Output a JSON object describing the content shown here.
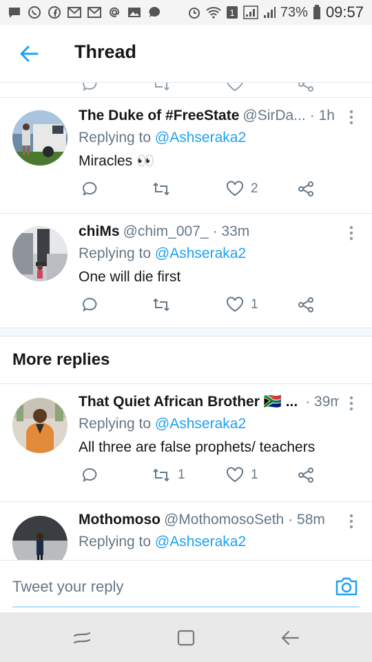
{
  "status_bar": {
    "battery": "73%",
    "time": "09:57",
    "sim_badge": "1",
    "colors": {
      "background": "#f4f4f4",
      "icon": "#555555"
    }
  },
  "header": {
    "title": "Thread",
    "back_icon": "arrow-left-icon"
  },
  "colors": {
    "accent": "#1da1f2",
    "text_primary": "#14171a",
    "text_secondary": "#657786",
    "divider": "#e1e8ed"
  },
  "tweets": [
    {
      "name": "The Duke of #FreeState",
      "handle": "@SirDa...",
      "time": "· 1h",
      "replying_prefix": "Replying to",
      "replying_to": "@Ashseraka2",
      "text": "Miracles 👀",
      "reply_count": "",
      "retweet_count": "",
      "like_count": "2"
    },
    {
      "name": "chiMs",
      "handle": "@chim_007_",
      "time": "· 33m",
      "replying_prefix": "Replying to",
      "replying_to": "@Ashseraka2",
      "text": "One will die first",
      "reply_count": "",
      "retweet_count": "",
      "like_count": "1"
    }
  ],
  "more_replies": {
    "title": "More replies",
    "tweets": [
      {
        "name": "That Quiet African Brother 🇿🇦 ...",
        "handle": "",
        "time": "· 39m",
        "replying_prefix": "Replying to",
        "replying_to": "@Ashseraka2",
        "text": "All three are false prophets/ teachers",
        "reply_count": "",
        "retweet_count": "1",
        "like_count": "1"
      },
      {
        "name": "Mothomoso",
        "handle": "@MothomosoSeth",
        "time": "· 58m",
        "replying_prefix": "Replying to",
        "replying_to": "@Ashseraka2",
        "text": ""
      }
    ]
  },
  "compose": {
    "placeholder": "Tweet your reply",
    "camera_icon": "camera-icon"
  },
  "nav_bar": {
    "buttons": [
      "recent-apps-icon",
      "home-icon",
      "back-icon"
    ]
  }
}
